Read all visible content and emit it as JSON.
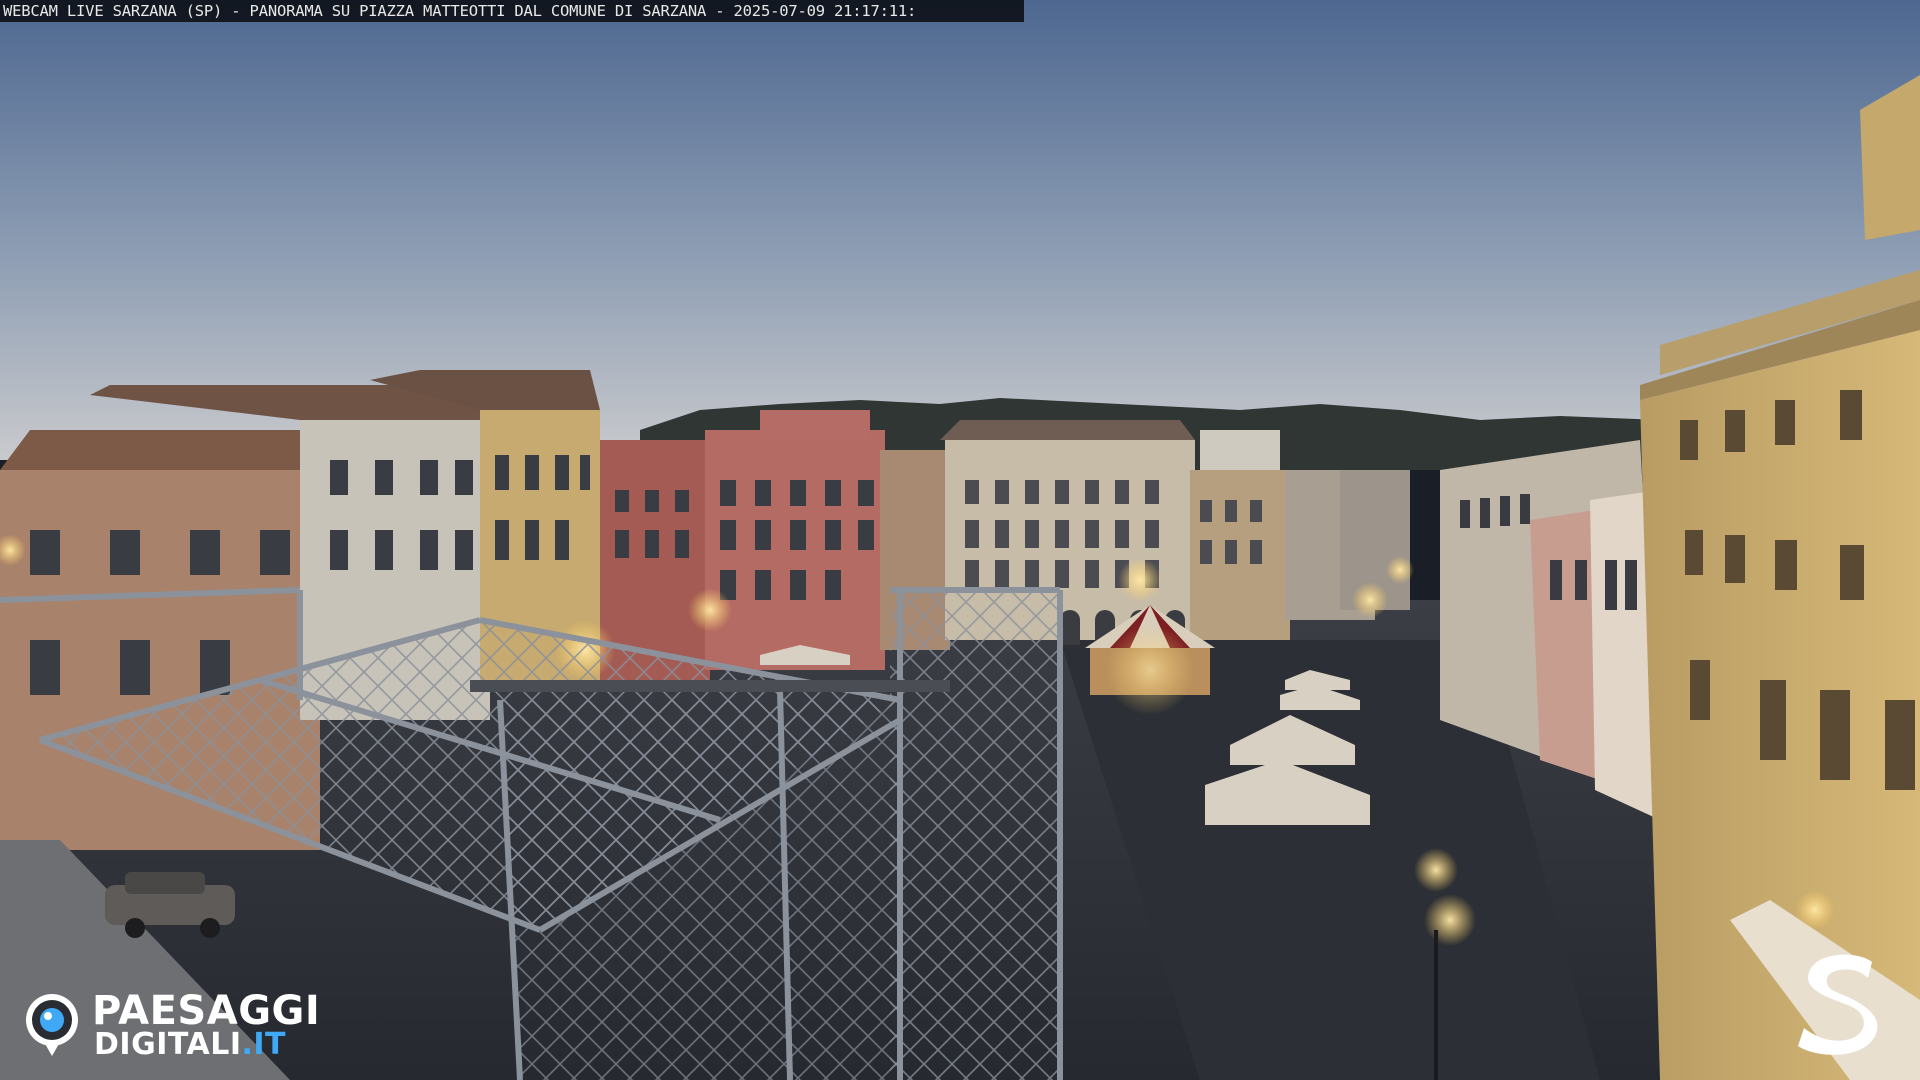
{
  "overlay": {
    "caption": "WEBCAM LIVE SARZANA (SP) - PANORAMA SU PIAZZA MATTEOTTI DAL COMUNE DI SARZANA - 2025-07-09  21:17:11:"
  },
  "watermark": {
    "brand_line1": "PAESAGGI",
    "brand_line2_main": "DIGITALI",
    "brand_line2_suffix": ".IT",
    "icon": "camera-lens-icon",
    "accent_color": "#3fa9f5"
  },
  "corner_logo": {
    "icon": "letter-s-logo",
    "color": "#ffffff"
  },
  "scene_colors": {
    "sky_top": "#4f6a93",
    "sky_bottom": "#c6cad0",
    "hills": "#2e3533",
    "pavement": "#2e3138",
    "building_yellow": "#c9ad6f",
    "building_red": "#a45b55",
    "building_cream": "#c8bba4",
    "scaffold": "#7d8490"
  }
}
